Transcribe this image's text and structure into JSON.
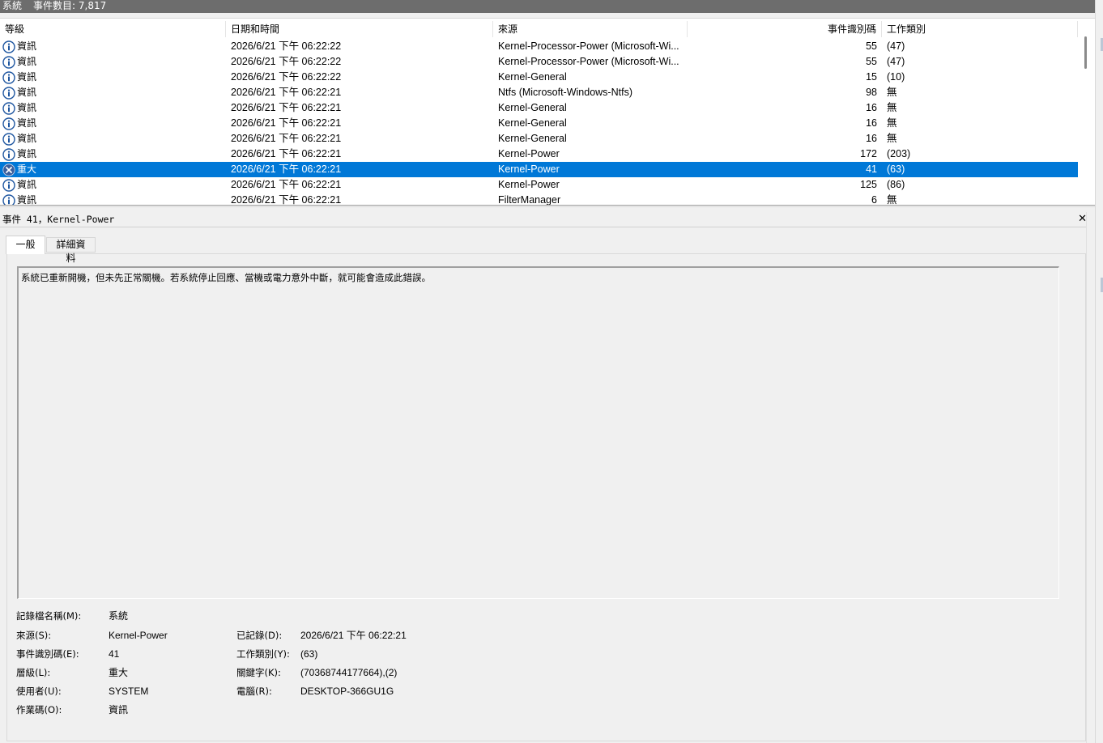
{
  "window": {
    "log_name": "系統",
    "event_count_label": "事件數目: 7,817"
  },
  "columns": {
    "level": "等級",
    "datetime": "日期和時間",
    "source": "來源",
    "event_id": "事件識別碼",
    "task_category": "工作類別"
  },
  "rows": [
    {
      "icon": "info-icon",
      "level": "資訊",
      "datetime": "2026/6/21 下午 06:22:22",
      "source": "Kernel-Processor-Power (Microsoft-Wi...",
      "event_id": "55",
      "task": "(47)",
      "selected": false
    },
    {
      "icon": "info-icon",
      "level": "資訊",
      "datetime": "2026/6/21 下午 06:22:22",
      "source": "Kernel-Processor-Power (Microsoft-Wi...",
      "event_id": "55",
      "task": "(47)",
      "selected": false
    },
    {
      "icon": "info-icon",
      "level": "資訊",
      "datetime": "2026/6/21 下午 06:22:22",
      "source": "Kernel-General",
      "event_id": "15",
      "task": "(10)",
      "selected": false
    },
    {
      "icon": "info-icon",
      "level": "資訊",
      "datetime": "2026/6/21 下午 06:22:21",
      "source": "Ntfs (Microsoft-Windows-Ntfs)",
      "event_id": "98",
      "task": "無",
      "selected": false
    },
    {
      "icon": "info-icon",
      "level": "資訊",
      "datetime": "2026/6/21 下午 06:22:21",
      "source": "Kernel-General",
      "event_id": "16",
      "task": "無",
      "selected": false
    },
    {
      "icon": "info-icon",
      "level": "資訊",
      "datetime": "2026/6/21 下午 06:22:21",
      "source": "Kernel-General",
      "event_id": "16",
      "task": "無",
      "selected": false
    },
    {
      "icon": "info-icon",
      "level": "資訊",
      "datetime": "2026/6/21 下午 06:22:21",
      "source": "Kernel-General",
      "event_id": "16",
      "task": "無",
      "selected": false
    },
    {
      "icon": "info-icon",
      "level": "資訊",
      "datetime": "2026/6/21 下午 06:22:21",
      "source": "Kernel-Power",
      "event_id": "172",
      "task": "(203)",
      "selected": false
    },
    {
      "icon": "critical-icon",
      "level": "重大",
      "datetime": "2026/6/21 下午 06:22:21",
      "source": "Kernel-Power",
      "event_id": "41",
      "task": "(63)",
      "selected": true
    },
    {
      "icon": "info-icon",
      "level": "資訊",
      "datetime": "2026/6/21 下午 06:22:21",
      "source": "Kernel-Power",
      "event_id": "125",
      "task": "(86)",
      "selected": false
    },
    {
      "icon": "info-icon",
      "level": "資訊",
      "datetime": "2026/6/21 下午 06:22:21",
      "source": "FilterManager",
      "event_id": "6",
      "task": "無",
      "selected": false
    }
  ],
  "detail": {
    "title": "事件 41，Kernel-Power",
    "tabs": {
      "general": "一般",
      "details": "詳細資料"
    },
    "description": "系統已重新開機，但未先正常關機。若系統停止回應、當機或電力意外中斷，就可能會造成此錯誤。",
    "properties": {
      "log_name_label": "記錄檔名稱(M):",
      "log_name_value": "系統",
      "source_label": "來源(S):",
      "source_value": "Kernel-Power",
      "logged_label": "已記錄(D):",
      "logged_value": "2026/6/21 下午 06:22:21",
      "event_id_label": "事件識別碼(E):",
      "event_id_value": "41",
      "task_label": "工作類別(Y):",
      "task_value": "(63)",
      "level_label": "層級(L):",
      "level_value": "重大",
      "keywords_label": "關鍵字(K):",
      "keywords_value": "(70368744177664),(2)",
      "user_label": "使用者(U):",
      "user_value": "SYSTEM",
      "computer_label": "電腦(R):",
      "computer_value": "DESKTOP-366GU1G",
      "opcode_label": "作業碼(O):",
      "opcode_value": "資訊"
    }
  },
  "colors": {
    "selection": "#0078d7",
    "titlebar": "#6d6d6d",
    "info_icon": "#1e56a0",
    "critical_icon": "#3a5f9e"
  }
}
